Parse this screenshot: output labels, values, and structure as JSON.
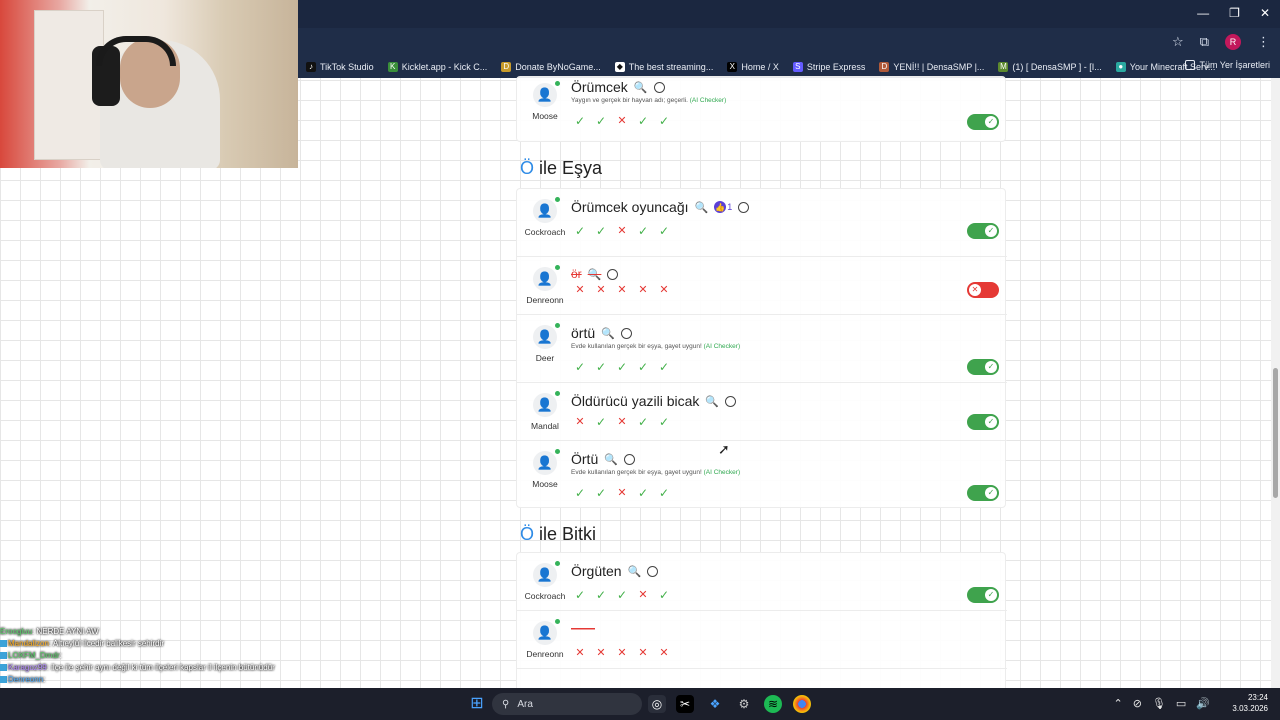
{
  "browser": {
    "bookmarks": [
      "TikTok Studio",
      "Kicklet.app - Kick C...",
      "Donate ByNoGame...",
      "The best streaming...",
      "Home / X",
      "Stripe Express",
      "YENİ!! | DensaSMP |...",
      "(1) [ DensaSMP ] - [I...",
      "Your Minecraft Serv..."
    ],
    "bookmarks_right": "Tüm Yer İşaretleri",
    "profile_initial": "R"
  },
  "game": {
    "top_row": {
      "user": "Moose",
      "word": "Örümcek",
      "checker_text": "Yaygın ve gerçek bir hayvan adı; geçerli.",
      "checker_tag": "(AI Checker)",
      "votes": [
        "ok",
        "ok",
        "no",
        "ok",
        "ok"
      ],
      "accepted": true
    },
    "sections": [
      {
        "letter": "Ö",
        "title": "ile Eşya",
        "rows": [
          {
            "user": "Cockroach",
            "word": "Örümcek oyuncağı",
            "likes": "1",
            "votes": [
              "ok",
              "ok",
              "no",
              "ok",
              "ok"
            ],
            "accepted": true
          },
          {
            "user": "Denreonn",
            "word": "ör",
            "rejected": true,
            "votes": [
              "no",
              "no",
              "no",
              "no",
              "no"
            ],
            "accepted": false
          },
          {
            "user": "Deer",
            "word": "örtü",
            "checker_text": "Evde kullanılan gerçek bir eşya, gayet uygun!",
            "checker_tag": "(AI Checker)",
            "votes": [
              "ok",
              "ok",
              "ok",
              "ok",
              "ok"
            ],
            "accepted": true
          },
          {
            "user": "Mandal",
            "word": "Öldürücü yazili bicak",
            "votes": [
              "no",
              "ok",
              "no",
              "ok",
              "ok"
            ],
            "accepted": true
          },
          {
            "user": "Moose",
            "word": "Örtü",
            "checker_text": "Evde kullanılan gerçek bir eşya, gayet uygun!",
            "checker_tag": "(AI Checker)",
            "votes": [
              "ok",
              "ok",
              "no",
              "ok",
              "ok"
            ],
            "accepted": true
          }
        ]
      },
      {
        "letter": "Ö",
        "title": "ile Bitki",
        "rows": [
          {
            "user": "Cockroach",
            "word": "Örgüten",
            "votes": [
              "ok",
              "ok",
              "ok",
              "no",
              "ok"
            ],
            "accepted": true
          },
          {
            "user": "Denreonn",
            "word": "——",
            "rejected": true,
            "votes": [
              "no",
              "no",
              "no",
              "no",
              "no"
            ],
            "accepted": false
          }
        ]
      }
    ]
  },
  "chat": [
    {
      "name": "Eroogluu",
      "msg": ": NERDE AYNI AW"
    },
    {
      "name": "Mandalizon",
      "msg": ": Altıeylül ilcedir balikesir sehirdir"
    },
    {
      "name": "LOXFM_Dmdr",
      "msg": ":"
    },
    {
      "name": "Karagoz99",
      "msg": ": ilçe ile şehir aynı değil ki tüm ilçeleri kapslar il ilçenin bütünüdür"
    },
    {
      "name": "Denreonn",
      "msg": ":"
    }
  ],
  "taskbar": {
    "search_placeholder": "Ara",
    "time": "23:24",
    "date": "3.03.2026"
  },
  "colors": {
    "accept": "#3fa34d",
    "reject": "#e53935",
    "letter": "#2e8be6",
    "check": "#43b04a"
  }
}
